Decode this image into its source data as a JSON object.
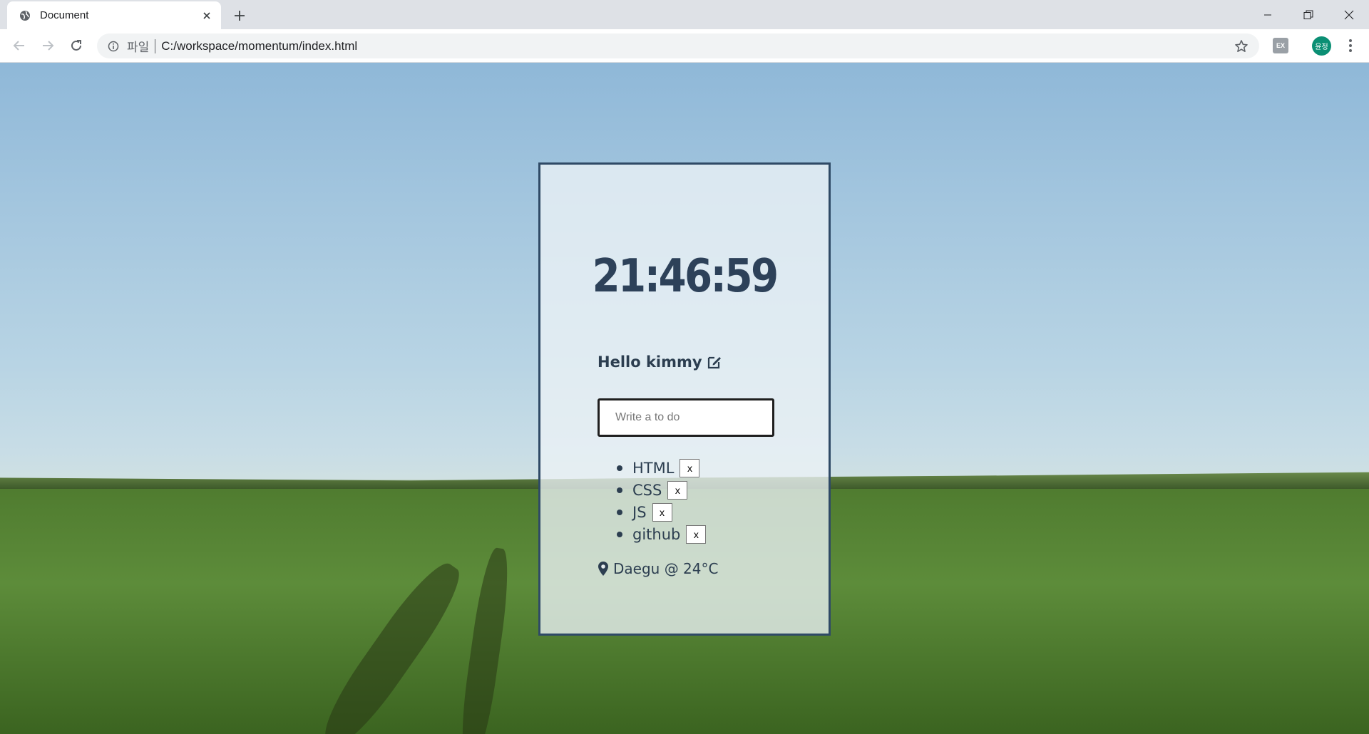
{
  "browser": {
    "tab_title": "Document",
    "scheme_label": "파일",
    "url": "C:/workspace/momentum/index.html",
    "profile_initials": "윤정",
    "extension_label": "EX"
  },
  "app": {
    "clock": "21:46:59",
    "greeting": "Hello kimmy",
    "todo_placeholder": "Write a to do",
    "todos": [
      {
        "text": "HTML",
        "delete_label": "x"
      },
      {
        "text": "CSS",
        "delete_label": "x"
      },
      {
        "text": "JS",
        "delete_label": "x"
      },
      {
        "text": "github",
        "delete_label": "x"
      }
    ],
    "weather": "Daegu @ 24°C"
  },
  "colors": {
    "card_border": "#2f4a66",
    "text_primary": "#2c3e50",
    "profile_bg": "#0b8f74"
  },
  "icons": {
    "tab": "globe-icon",
    "greeting_edit": "edit-icon",
    "weather": "map-pin-icon"
  }
}
